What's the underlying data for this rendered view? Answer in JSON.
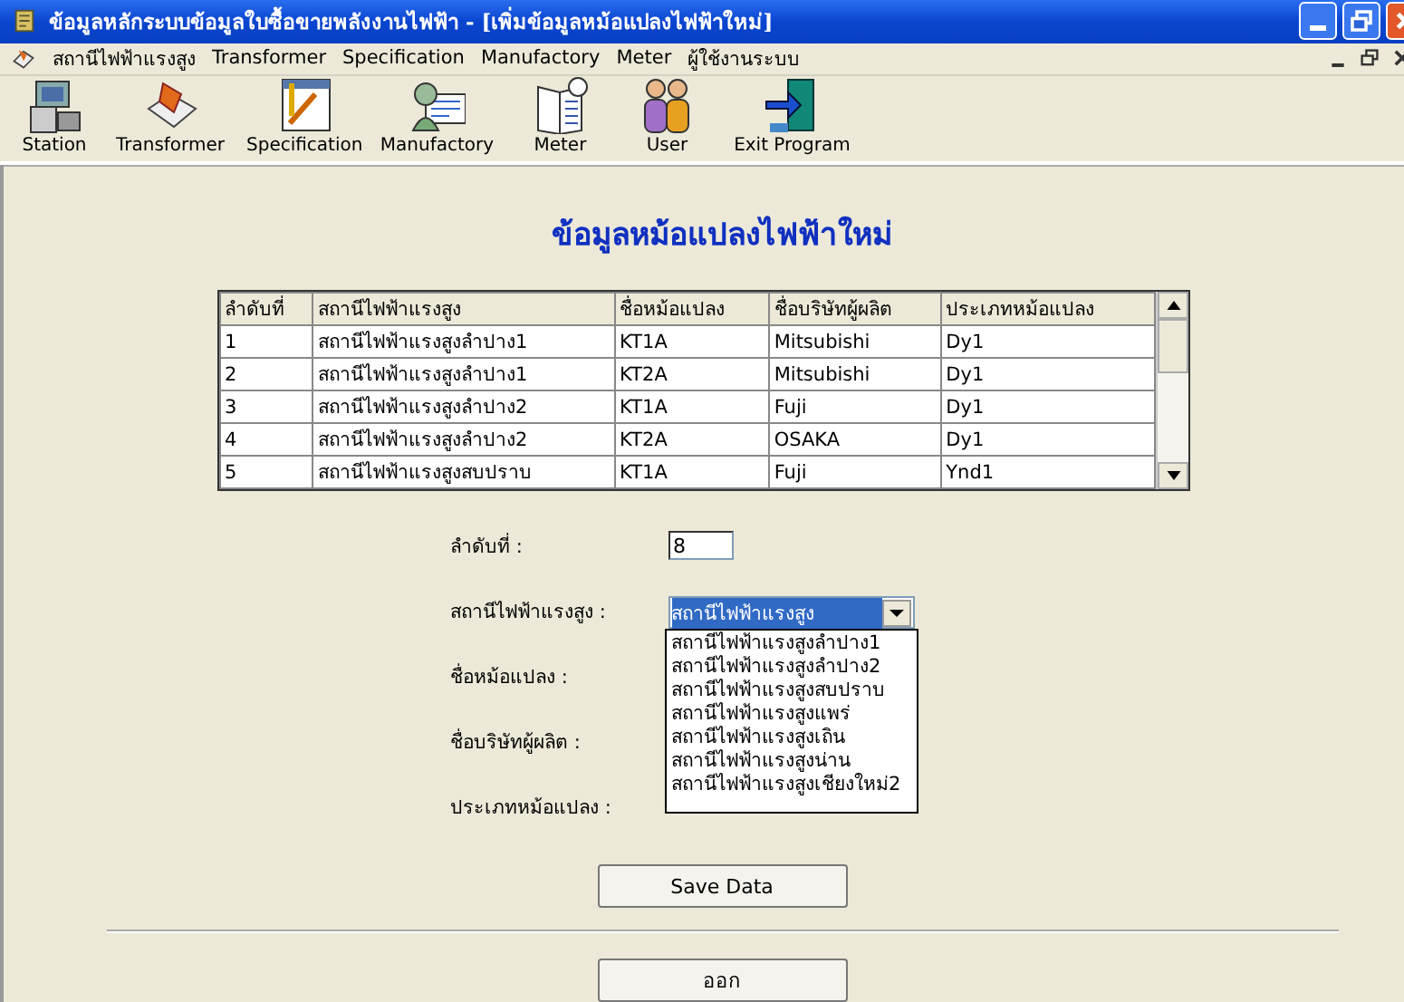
{
  "window": {
    "title": "ข้อมูลหลักระบบข้อมูลใบซื้อขายพลังงานไฟฟ้า - [เพิ่มข้อมูลหม้อแปลงไฟฟ้าใหม่]"
  },
  "menu": [
    "สถานีไฟฟ้าแรงสูง",
    "Transformer",
    "Specification",
    "Manufactory",
    "Meter",
    "ผู้ใช้งานระบบ"
  ],
  "toolbar": [
    {
      "label": "Station",
      "kind": "station"
    },
    {
      "label": "Transformer",
      "kind": "transformer"
    },
    {
      "label": "Specification",
      "kind": "specification"
    },
    {
      "label": "Manufactory",
      "kind": "manufactory"
    },
    {
      "label": "Meter",
      "kind": "meter"
    },
    {
      "label": "User",
      "kind": "user"
    },
    {
      "label": "Exit Program",
      "kind": "exit"
    }
  ],
  "heading": "ข้อมูลหม้อแปลงไฟฟ้าใหม่",
  "table": {
    "columns": [
      "ลำดับที่",
      "สถานีไฟฟ้าแรงสูง",
      "ชื่อหม้อแปลง",
      "ชื่อบริษัทผู้ผลิต",
      "ประเภทหม้อแปลง"
    ],
    "rows": [
      [
        "1",
        "สถานีไฟฟ้าแรงสูงลำปาง1",
        "KT1A",
        "Mitsubishi",
        "Dy1"
      ],
      [
        "2",
        "สถานีไฟฟ้าแรงสูงลำปาง1",
        "KT2A",
        "Mitsubishi",
        "Dy1"
      ],
      [
        "3",
        "สถานีไฟฟ้าแรงสูงลำปาง2",
        "KT1A",
        "Fuji",
        "Dy1"
      ],
      [
        "4",
        "สถานีไฟฟ้าแรงสูงลำปาง2",
        "KT2A",
        "OSAKA",
        "Dy1"
      ],
      [
        "5",
        "สถานีไฟฟ้าแรงสูงสบปราบ",
        "KT1A",
        "Fuji",
        "Ynd1"
      ]
    ]
  },
  "form": [
    {
      "label": "ลำดับที่ :",
      "kind": "text",
      "value": "8"
    },
    {
      "label": "สถานีไฟฟ้าแรงสูง :",
      "kind": "dropdown",
      "value": "สถานีไฟฟ้าแรงสูง",
      "expanded": true,
      "options": [
        "สถานีไฟฟ้าแรงสูงลำปาง1",
        "สถานีไฟฟ้าแรงสูงลำปาง2",
        "สถานีไฟฟ้าแรงสูงสบปราบ",
        "สถานีไฟฟ้าแรงสูงแพร่",
        "สถานีไฟฟ้าแรงสูงเถิน",
        "สถานีไฟฟ้าแรงสูงน่าน",
        "สถานีไฟฟ้าแรงสูงเชียงใหม่2"
      ]
    },
    {
      "label": "ชื่อหม้อแปลง :",
      "kind": "hidden"
    },
    {
      "label": "ชื่อบริษัทผู้ผลิต :",
      "kind": "hidden"
    },
    {
      "label": "ประเภทหม้อแปลง :",
      "kind": "hidden"
    }
  ],
  "buttons": [
    "Save Data",
    "ออก"
  ]
}
